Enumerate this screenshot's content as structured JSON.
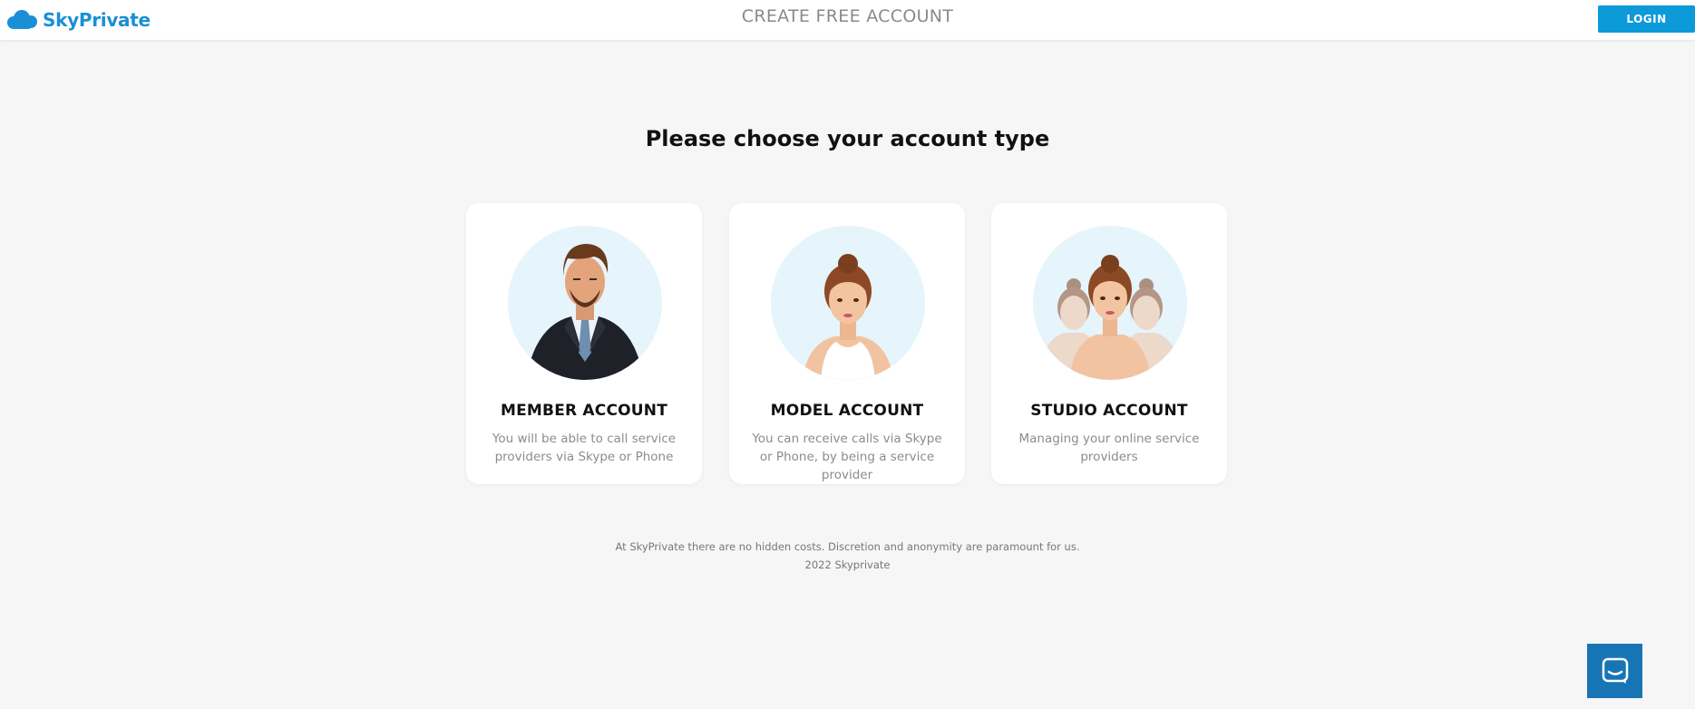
{
  "header": {
    "logo_text": "SkyPrivate",
    "title": "CREATE FREE ACCOUNT",
    "login_label": "LOGIN"
  },
  "main": {
    "heading": "Please choose your account type",
    "cards": [
      {
        "title": "MEMBER ACCOUNT",
        "description": "You will be able to call service providers via Skype or Phone",
        "icon": "man-in-suit-avatar"
      },
      {
        "title": "MODEL ACCOUNT",
        "description": "You can receive calls via Skype or Phone, by being a service provider",
        "icon": "woman-avatar"
      },
      {
        "title": "STUDIO ACCOUNT",
        "description": "Managing your online service providers",
        "icon": "group-of-women-avatar"
      }
    ]
  },
  "footer": {
    "note": "At SkyPrivate there are no hidden costs. Discretion and anonymity are paramount for us.",
    "copyright": "2022 Skyprivate"
  },
  "chat_widget": {
    "icon": "chat-bubble-icon"
  },
  "colors": {
    "brand": "#1a8fd6",
    "login_button": "#0d9ad8",
    "chat_button": "#1775b6",
    "background": "#f6f6f6",
    "avatar_bg": "#e6f4fc"
  }
}
